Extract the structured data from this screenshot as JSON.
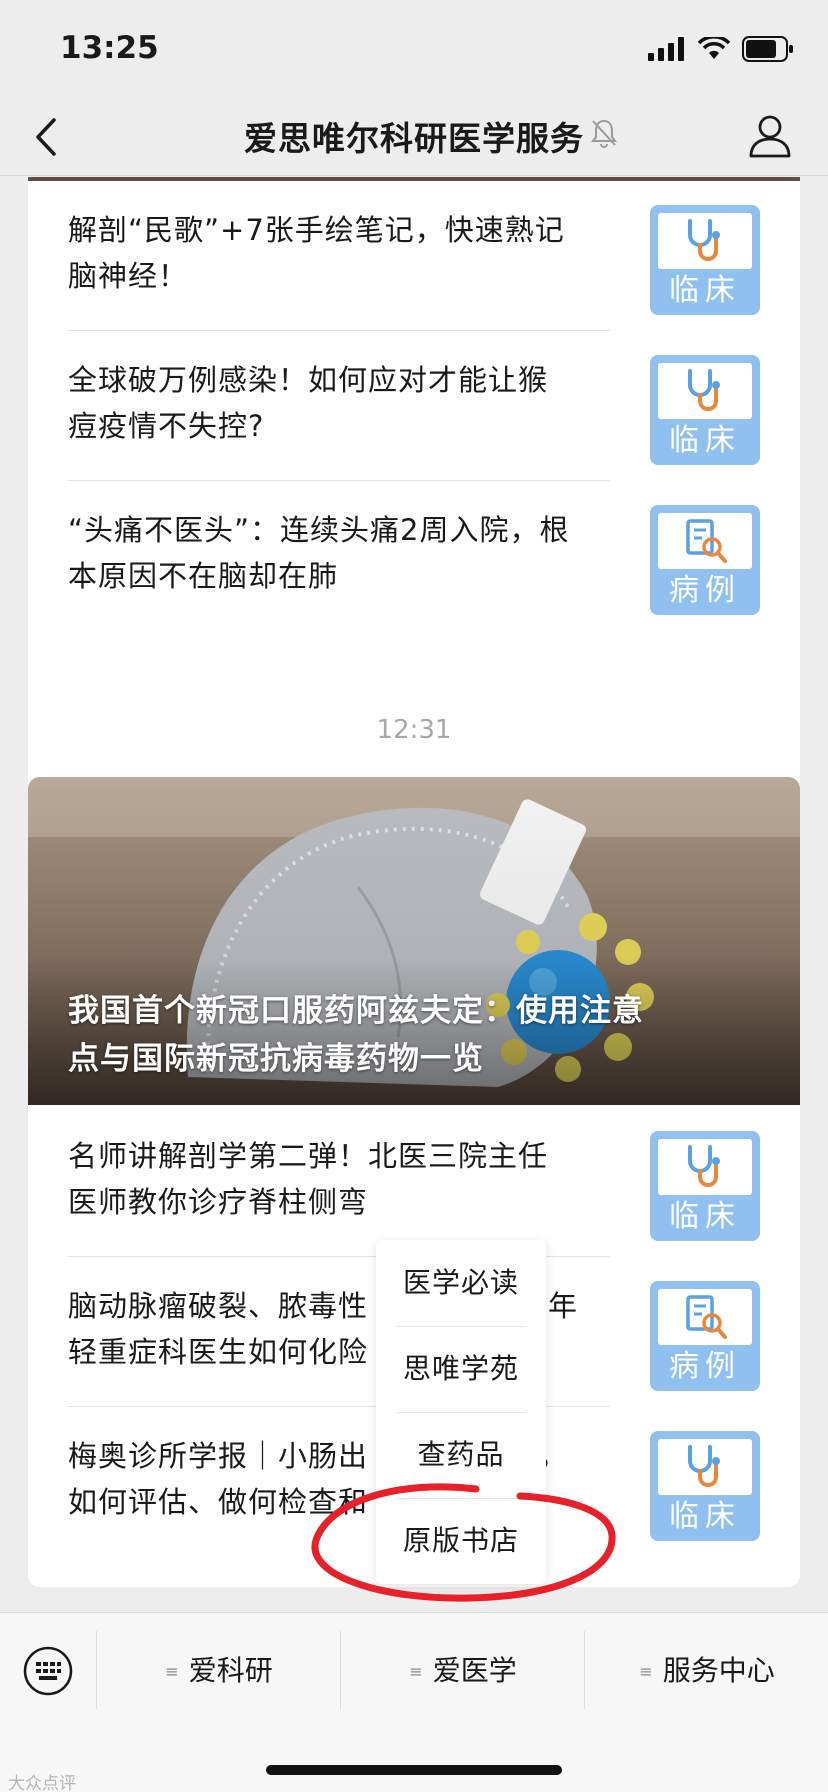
{
  "status": {
    "time": "13:25"
  },
  "nav": {
    "title": "爱思唯尔科研医学服务"
  },
  "timestamp": "12:31",
  "group1": [
    {
      "title_l1": "解剖“民歌”+7张手绘笔记，快速熟记",
      "title_l2": "脑神经！",
      "tag": "临床",
      "icon": "stethoscope-icon"
    },
    {
      "title_l1": "全球破万例感染！如何应对才能让猴",
      "title_l2": "痘疫情不失控?",
      "tag": "临床",
      "icon": "stethoscope-icon"
    },
    {
      "title_l1": "“头痛不医头”：连续头痛2周入院，根",
      "title_l2": "本原因不在脑却在肺",
      "tag": "病例",
      "icon": "case-file-icon"
    }
  ],
  "hero": {
    "title_l1": "我国首个新冠口服药阿兹夫定：使用注意",
    "title_l2": "点与国际新冠抗病毒药物一览"
  },
  "group2": [
    {
      "title_l1": "名师讲解剖学第二弹！北医三院主任",
      "title_l2": "医师教你诊疗脊柱侧弯",
      "tag": "临床",
      "icon": "stethoscope-icon"
    },
    {
      "title_l1": "脑动脉瘤破裂、脓毒性",
      "title_l1b": "立年",
      "title_l2": "轻重症科医生如何化险",
      "tag": "病例",
      "icon": "case-file-icon"
    },
    {
      "title_l1": "梅奥诊所学报｜小肠出",
      "title_l1b": "面，",
      "title_l2": "如何评估、做何检查和",
      "tag": "临床",
      "icon": "stethoscope-icon"
    }
  ],
  "popup": [
    "医学必读",
    "思唯学苑",
    "查药品",
    "原版书店"
  ],
  "menu": [
    "爱科研",
    "爱医学",
    "服务中心"
  ],
  "watermark": "大众点评"
}
